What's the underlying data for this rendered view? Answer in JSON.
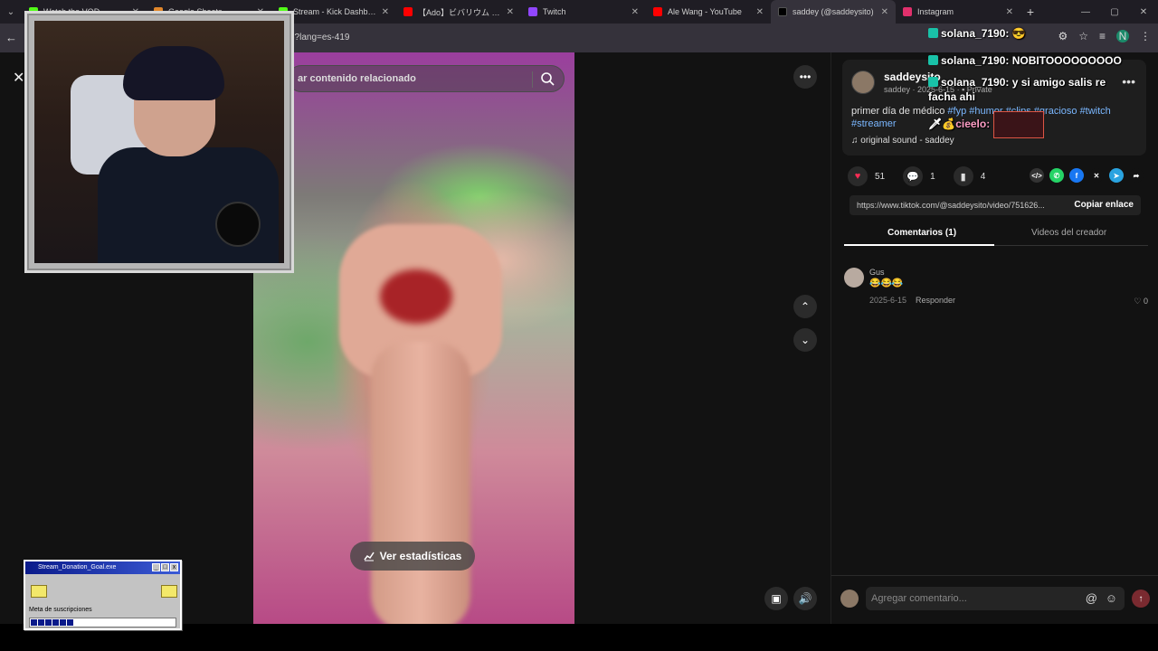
{
  "browser": {
    "tabs": [
      {
        "label": "Watch the VOD ...",
        "favicon_color": "#53fc18"
      },
      {
        "label": "Google Sheets",
        "favicon_color": "#e1872b"
      },
      {
        "label": "Stream - Kick Dashboard",
        "favicon_color": "#53fc18"
      },
      {
        "label": "【Ado】ビバリウム - YouTube",
        "favicon_color": "#ff0000"
      },
      {
        "label": "Twitch",
        "favicon_color": "#9146ff"
      },
      {
        "label": "Ale Wang - YouTube",
        "favicon_color": "#ff0000"
      },
      {
        "label": "saddey (@saddeysito)",
        "favicon_color": "#111111"
      },
      {
        "label": "Instagram",
        "favicon_color": "#e1306c"
      }
    ],
    "url_fragment": "3?lang=es-419",
    "profile_initial": "N"
  },
  "search": {
    "placeholder": "ar contenido relacionado"
  },
  "video": {
    "stats_label": "Ver estadísticas"
  },
  "post": {
    "username": "saddeysito",
    "display_name": "saddey",
    "date": "2025-6-15",
    "privacy": "Private",
    "description_prefix": "primer día de médico",
    "tags": [
      "#fyp",
      "#humor",
      "#clips",
      "#gracioso",
      "#twitch",
      "#streamer"
    ],
    "sound": "original sound - saddey",
    "likes": "51",
    "comments": "1",
    "saves": "4",
    "link": "https://www.tiktok.com/@saddeysito/video/751626...",
    "copy_label": "Copiar enlace"
  },
  "tabs": {
    "comments": "Comentarios (1)",
    "creator_videos": "Videos del creador"
  },
  "comment": {
    "user": "Gus",
    "text": "😂😂😂",
    "date": "2025-6-15",
    "reply": "Responder",
    "likes": "0"
  },
  "composer": {
    "placeholder": "Agregar comentario..."
  },
  "chat": {
    "messages": [
      {
        "user": "solana_7190:",
        "text": ""
      },
      {
        "user": "solana_7190:",
        "text": "NOBITOOOOOOOOO"
      },
      {
        "user": "solana_7190:",
        "text": "y si amigo salis re"
      },
      {
        "user": "",
        "text": "facha ahi"
      },
      {
        "user": "cieelo:",
        "text": ""
      }
    ]
  },
  "donation": {
    "title": "Stream_Donation_Goal.exe",
    "meta_label": "Meta de suscripciones",
    "progress": 0.3
  }
}
